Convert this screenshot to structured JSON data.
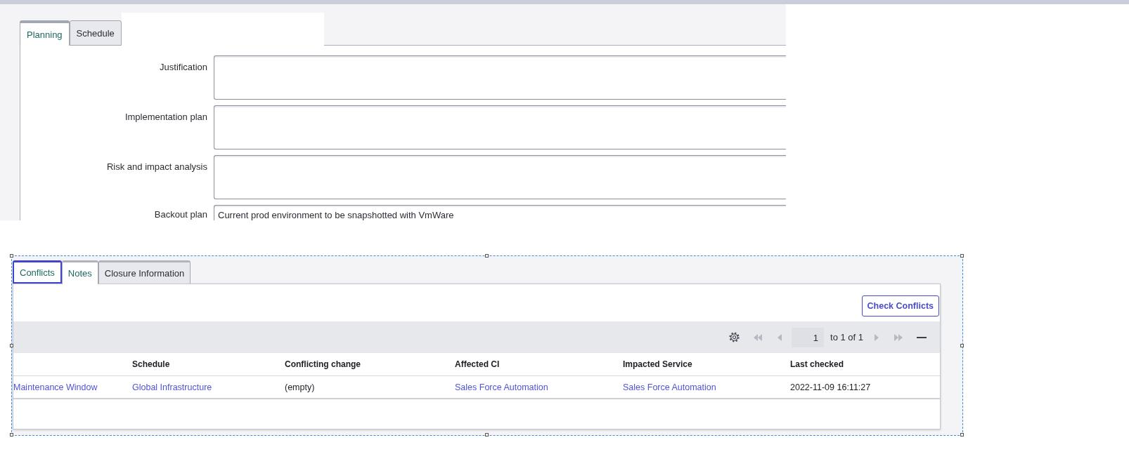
{
  "planning_form": {
    "tabs": [
      {
        "label": "Planning",
        "selected": true
      },
      {
        "label": "Schedule",
        "selected": false
      }
    ],
    "fields": [
      {
        "label": "Justification",
        "kind": "textarea"
      },
      {
        "label": "Implementation plan",
        "kind": "textarea"
      },
      {
        "label": "Risk and impact analysis",
        "kind": "textarea"
      },
      {
        "label": "Backout plan",
        "kind": "text",
        "value": "Current prod environment to be snapshotted with VmWare"
      }
    ]
  },
  "related_lists": {
    "tabs": [
      {
        "label": "Conflicts",
        "selected": false,
        "focused": true
      },
      {
        "label": "Notes",
        "selected": true,
        "focused": false
      },
      {
        "label": "Closure Information",
        "selected": false,
        "focused": false
      }
    ],
    "check_button": "Check Conflicts",
    "toolbar": {
      "back": [
        {
          "kind": "first",
          "disabled": true
        },
        {
          "kind": "prev",
          "disabled": true
        }
      ],
      "page": "1",
      "range": "to 1 of 1",
      "forward": [
        {
          "kind": "next",
          "disabled": true
        },
        {
          "kind": "last",
          "disabled": true
        }
      ]
    },
    "table": {
      "columns": [
        "",
        "Schedule",
        "Conflicting change",
        "Affected CI",
        "Impacted Service",
        "Last checked"
      ],
      "rows": [
        {
          "cells": [
            {
              "text": "Maintenance Window",
              "link": true
            },
            {
              "text": "Global Infrastructure",
              "link": true
            },
            {
              "text": "(empty)",
              "link": false
            },
            {
              "text": "Sales Force Automation",
              "link": true
            },
            {
              "text": "Sales Force Automation",
              "link": true
            },
            {
              "text": "2022-11-09 16:11:27",
              "link": false
            }
          ]
        }
      ]
    }
  }
}
